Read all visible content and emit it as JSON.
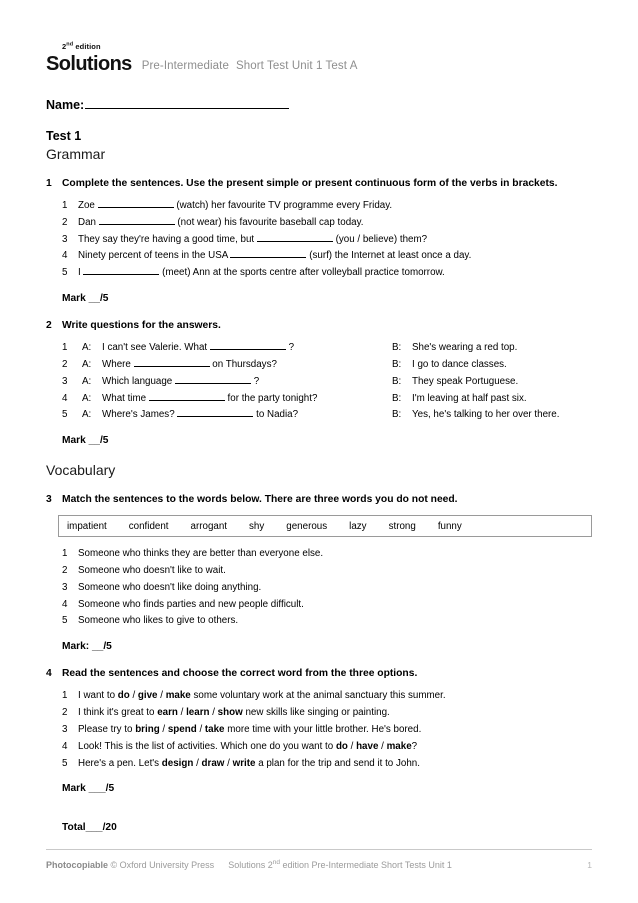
{
  "header": {
    "logo_main": "Solutions",
    "logo_edition_prefix": "2",
    "logo_edition_ord": "nd",
    "logo_edition_suffix": " edition",
    "level": "Pre-Intermediate",
    "test_ref": "Short Test Unit 1 Test A"
  },
  "name_label": "Name:",
  "test_title": "Test 1",
  "sections": {
    "grammar": "Grammar",
    "vocabulary": "Vocabulary"
  },
  "exercise1": {
    "number": "1",
    "instruction": "Complete the sentences. Use the present simple or present continuous form of the verbs in brackets.",
    "items": [
      {
        "n": "1",
        "before": "Zoe ",
        "after": " (watch) her favourite TV programme every Friday."
      },
      {
        "n": "2",
        "before": "Dan ",
        "after": " (not wear) his favourite baseball cap today."
      },
      {
        "n": "3",
        "before": "They say they're having a good time, but ",
        "after": " (you / believe) them?"
      },
      {
        "n": "4",
        "before": "Ninety percent of teens in the USA ",
        "after": " (surf) the Internet at least once a day."
      },
      {
        "n": "5",
        "before": "I ",
        "after": " (meet) Ann at the sports centre after volleyball practice tomorrow."
      }
    ],
    "mark": "Mark __/5"
  },
  "exercise2": {
    "number": "2",
    "instruction": "Write questions for the answers.",
    "items": [
      {
        "n": "1",
        "a_label": "A:",
        "a_before": "I can't see Valerie. What ",
        "a_after": " ?",
        "b_label": "B:",
        "b_text": "She's wearing a red top."
      },
      {
        "n": "2",
        "a_label": "A:",
        "a_before": "Where ",
        "a_after": " on Thursdays?",
        "b_label": "B:",
        "b_text": "I go to dance classes."
      },
      {
        "n": "3",
        "a_label": "A:",
        "a_before": "Which language ",
        "a_after": " ?",
        "b_label": "B:",
        "b_text": "They speak Portuguese."
      },
      {
        "n": "4",
        "a_label": "A:",
        "a_before": "What time ",
        "a_after": " for the party tonight?",
        "b_label": "B:",
        "b_text": "I'm leaving at half past six."
      },
      {
        "n": "5",
        "a_label": "A:",
        "a_before": "Where's James? ",
        "a_after": " to Nadia?",
        "b_label": "B:",
        "b_text": "Yes, he's talking to her over there."
      }
    ],
    "mark": "Mark __/5"
  },
  "exercise3": {
    "number": "3",
    "instruction": "Match the sentences to the words below. There are three words you do not need.",
    "word_bank": [
      "impatient",
      "confident",
      "arrogant",
      "shy",
      "generous",
      "lazy",
      "strong",
      "funny"
    ],
    "items": [
      {
        "n": "1",
        "text": "Someone who thinks they are better than everyone else."
      },
      {
        "n": "2",
        "text": "Someone who doesn't like to wait."
      },
      {
        "n": "3",
        "text": "Someone who doesn't like doing anything."
      },
      {
        "n": "4",
        "text": "Someone who finds parties and new people difficult."
      },
      {
        "n": "5",
        "text": "Someone who likes to give to others."
      }
    ],
    "mark": "Mark: __/5"
  },
  "exercise4": {
    "number": "4",
    "instruction": "Read the sentences and choose the correct word from the three options.",
    "items": [
      {
        "n": "1",
        "pre": "I want to ",
        "o1": "do",
        "o2": "give",
        "o3": "make",
        "post": " some voluntary work at the animal sanctuary this summer."
      },
      {
        "n": "2",
        "pre": "I think it's great to ",
        "o1": "earn",
        "o2": "learn",
        "o3": "show",
        "post": " new skills like singing or painting."
      },
      {
        "n": "3",
        "pre": "Please try to ",
        "o1": "bring",
        "o2": "spend",
        "o3": "take",
        "post": " more time with your little brother. He's bored."
      },
      {
        "n": "4",
        "pre": "Look! This is the list of activities. Which one do you want to ",
        "o1": "do",
        "o2": "have",
        "o3": "make",
        "post": "?"
      },
      {
        "n": "5",
        "pre": "Here's a pen. Let's ",
        "o1": "design",
        "o2": "draw",
        "o3": "write",
        "post": " a plan for the trip and send it to John."
      }
    ],
    "mark": "Mark ___/5"
  },
  "total": "Total___/20",
  "footer": {
    "photocopiable": "Photocopiable",
    "copyright": "© Oxford University Press",
    "solutions": "Solutions 2",
    "solutions_ord": "nd",
    "solutions_rest": " edition",
    "tail": "Pre-Intermediate Short Tests Unit 1",
    "page": "1"
  }
}
